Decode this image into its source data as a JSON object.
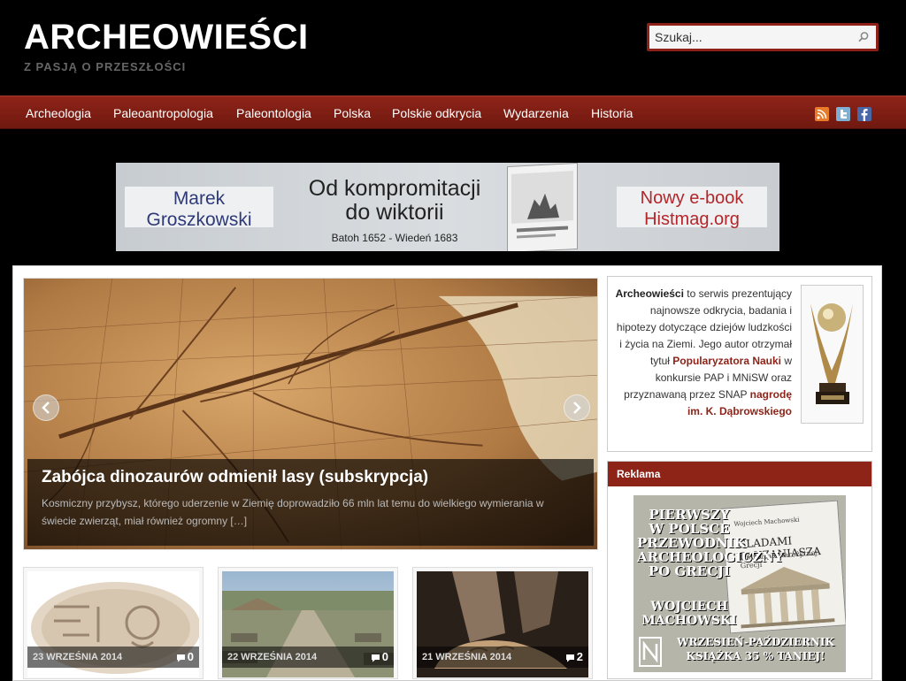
{
  "site": {
    "title": "ARCHEOWIEŚCI",
    "tagline": "Z PASJĄ O PRZESZŁOŚCI"
  },
  "search": {
    "placeholder": "Szukaj..."
  },
  "nav": {
    "items": [
      "Archeologia",
      "Paleoantropologia",
      "Paleontologia",
      "Polska",
      "Polskie odkrycia",
      "Wydarzenia",
      "Historia"
    ],
    "social": [
      "rss-icon",
      "twitter-icon",
      "facebook-icon"
    ]
  },
  "banner": {
    "author": [
      "Marek",
      "Groszkowski"
    ],
    "title": [
      "Od kompromitacji",
      "do wiktorii"
    ],
    "subtitle": "Batoh 1652 - Wiedeń 1683",
    "promo": [
      "Nowy e-book",
      "Histmag.org"
    ]
  },
  "slider": {
    "title": "Zabójca dinozaurów odmienił lasy (subskrypcja)",
    "excerpt": "Kosmiczny przybysz, którego uderzenie w Ziemię doprowadziło 66 mln lat temu do wielkiego wymierania w świecie zwierząt, miał również ogromny […]"
  },
  "posts": [
    {
      "date": "23 WRZEŚNIA 2014",
      "comments": "0"
    },
    {
      "date": "22 WRZEŚNIA 2014",
      "comments": "0"
    },
    {
      "date": "21 WRZEŚNIA 2014",
      "comments": "2"
    }
  ],
  "about": {
    "site_name": "Archeowieści",
    "text1": " to serwis prezentujący najnowsze odkrycia, badania i hipotezy dotyczące dziejów ludzkości i życia na Ziemi. Jego autor otrzymał tytuł ",
    "link1": "Popularyzatora Nauki",
    "text2": " w konkursie PAP i MNiSW oraz przyznawaną przez SNAP ",
    "link2": "nagrodę im. K. Dąbrowskiego"
  },
  "ad_widget": {
    "title": "Reklama",
    "headline": [
      "PIERWSZY",
      "W POLSCE",
      "PRZEWODNIK",
      "ARCHEOLOGICZNY",
      "PO GRECJI"
    ],
    "author": [
      "WOJCIECH",
      "MACHOWSKI"
    ],
    "book_author": "Wojciech Machowski",
    "book_title": "ŚLADAMI PAUZANIASZA",
    "book_subtitle": "Podróż po starożytnej Grecji",
    "promo": [
      "WRZESIEŃ-PAŹDZIERNIK",
      "KSIĄŻKA 35 % TANIEJ!"
    ]
  }
}
